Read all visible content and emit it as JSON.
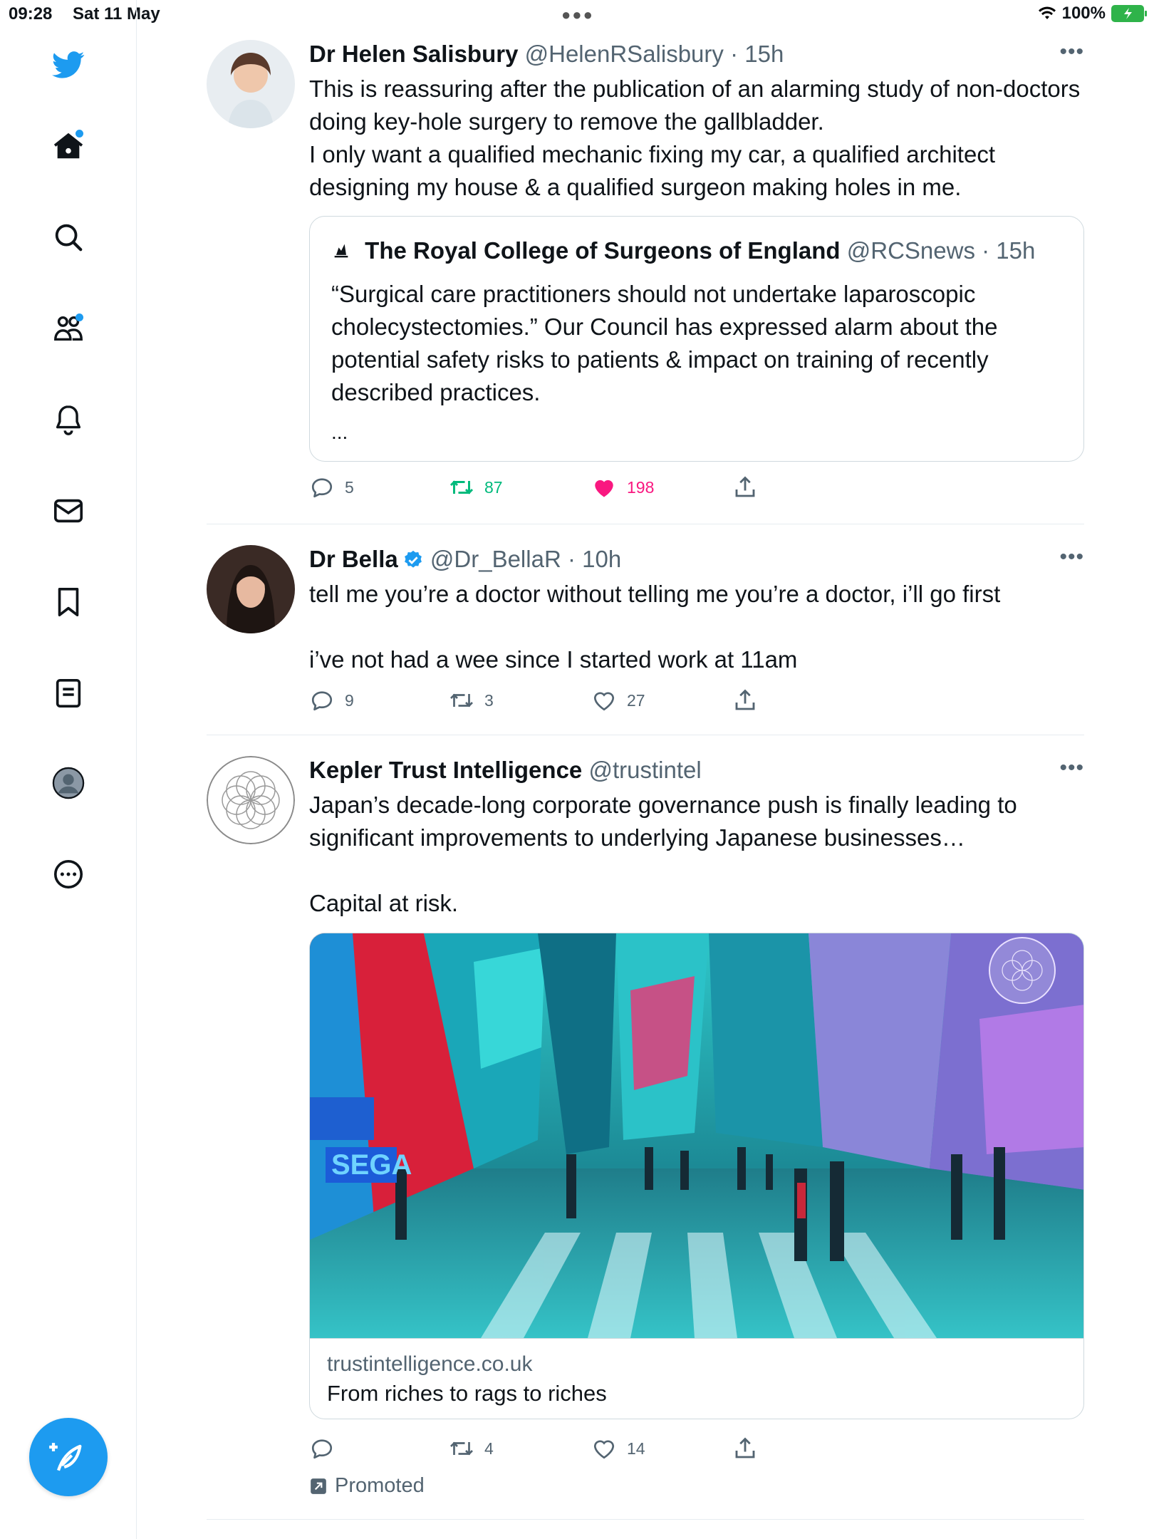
{
  "status": {
    "time": "09:28",
    "date": "Sat 11 May",
    "battery": "100%"
  },
  "sidebar": {
    "items": [
      "twitter-logo",
      "home",
      "explore",
      "communities",
      "notifications",
      "messages",
      "bookmarks",
      "lists",
      "profile",
      "more"
    ]
  },
  "tweets": [
    {
      "name": "Dr Helen Salisbury",
      "handle": "@HelenRSalisbury",
      "time": "· 15h",
      "text": "This is reassuring after the publication of an alarming study of non-doctors doing key-hole surgery to remove the gallbladder.\nI only want a qualified mechanic fixing my car, a qualified architect designing my house & a qualified surgeon making holes in me.",
      "quote": {
        "name": "The Royal College of Surgeons of England",
        "handle": "@RCSnews",
        "time": "· 15h",
        "text": "“Surgical care practitioners should not undertake laparoscopic cholecystectomies.” Our Council has expressed alarm about the potential safety risks to patients & impact on training of recently described practices.",
        "ellipsis": "..."
      },
      "replies": "5",
      "retweets": "87",
      "likes": "198"
    },
    {
      "name": "Dr Bella",
      "handle": "@Dr_BellaR",
      "time": "· 10h",
      "text": "tell me you’re a doctor without telling me you’re a doctor, i’ll go first\n\ni’ve not had a wee since I started work at 11am",
      "replies": "9",
      "retweets": "3",
      "likes": "27"
    },
    {
      "name": "Kepler Trust Intelligence",
      "handle": "@trustintel",
      "text": "Japan’s decade-long corporate governance push is finally leading to significant improvements to underlying Japanese businesses…\n\nCapital at risk.",
      "card": {
        "domain": "trustintelligence.co.uk",
        "title": "From riches to rags to riches"
      },
      "replies": "",
      "retweets": "4",
      "likes": "14",
      "promoted": "Promoted"
    }
  ],
  "colors": {
    "accent": "#1d9bf0",
    "like": "#f91880",
    "retweet": "#00ba7c",
    "muted": "#536471"
  }
}
